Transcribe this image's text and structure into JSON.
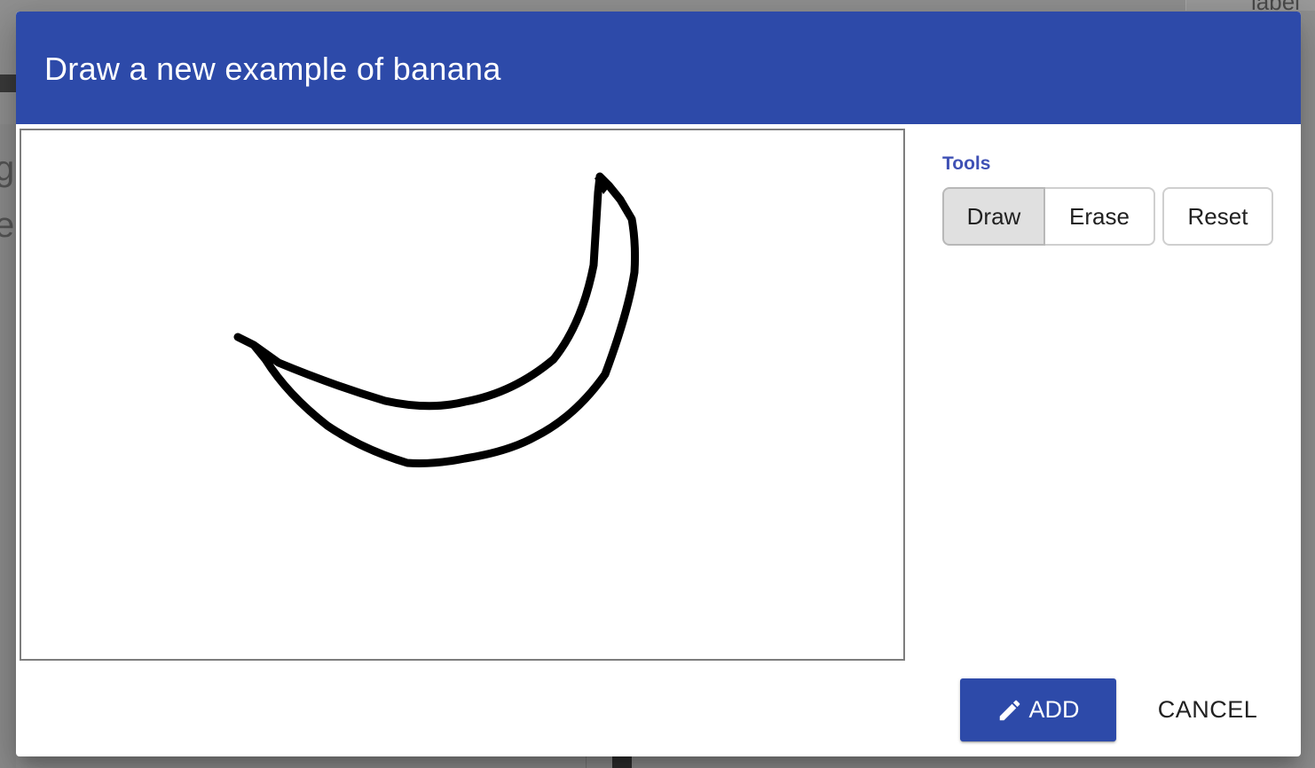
{
  "background": {
    "corner_label": "label",
    "partial_chars": [
      "g",
      "e"
    ]
  },
  "dialog": {
    "title": "Draw a new example of banana",
    "tools": {
      "label": "Tools",
      "draw_label": "Draw",
      "erase_label": "Erase",
      "reset_label": "Reset",
      "active_tool": "Draw"
    },
    "actions": {
      "add_label": "ADD",
      "add_icon": "pencil-icon",
      "cancel_label": "CANCEL"
    }
  },
  "colors": {
    "header": "#2d4aa9",
    "accent": "#3f51b5",
    "stroke": "#000000"
  }
}
